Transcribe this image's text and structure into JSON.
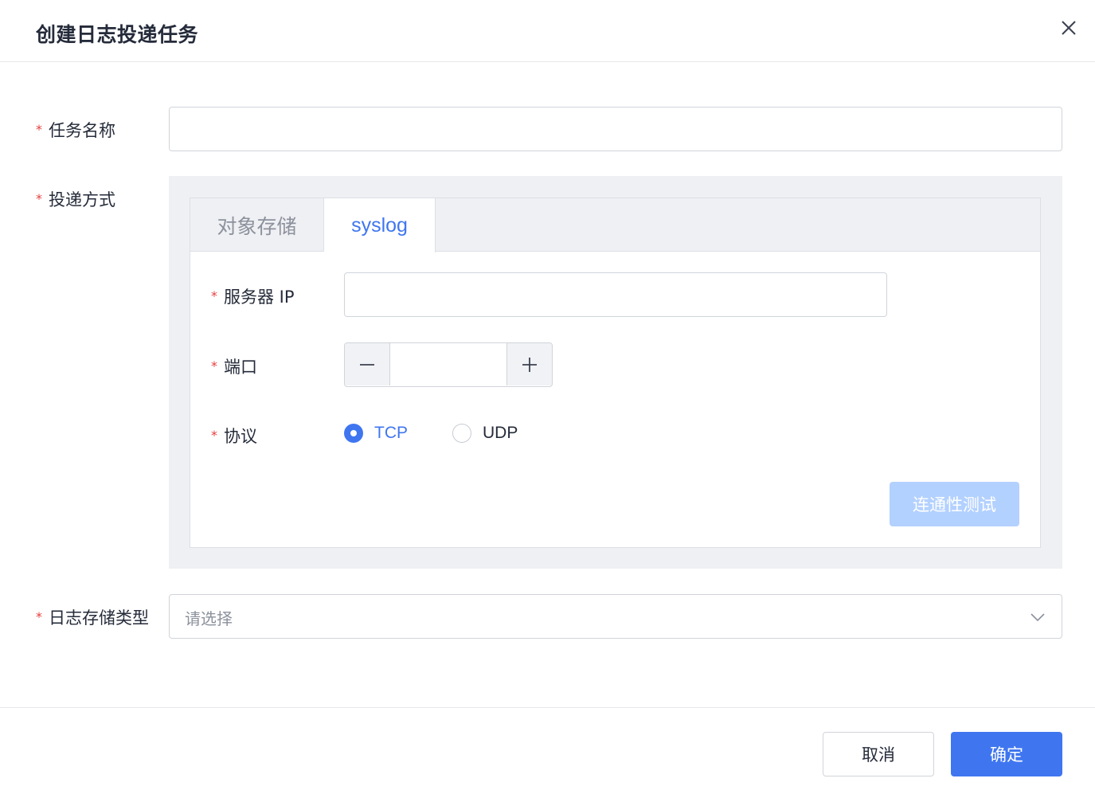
{
  "dialog": {
    "title": "创建日志投递任务",
    "close_icon": "close-icon"
  },
  "form": {
    "task_name": {
      "required_mark": "*",
      "label": "任务名称",
      "value": "",
      "placeholder": ""
    },
    "delivery_method": {
      "required_mark": "*",
      "label": "投递方式",
      "tabs": [
        {
          "label": "对象存储",
          "active": false
        },
        {
          "label": "syslog",
          "active": true
        }
      ],
      "server_ip": {
        "required_mark": "*",
        "label": "服务器 IP",
        "value": ""
      },
      "port": {
        "required_mark": "*",
        "label": "端口",
        "value": "",
        "minus_glyph": "—",
        "plus_glyph": "+"
      },
      "protocol": {
        "required_mark": "*",
        "label": "协议",
        "options": [
          {
            "label": "TCP",
            "selected": true
          },
          {
            "label": "UDP",
            "selected": false
          }
        ]
      },
      "test_button": "连通性测试"
    },
    "storage_type": {
      "required_mark": "*",
      "label": "日志存储类型",
      "placeholder": "请选择",
      "chevron_icon": "chevron-down-icon"
    }
  },
  "footer": {
    "cancel_label": "取消",
    "ok_label": "确定"
  },
  "colors": {
    "primary": "#3f76f0",
    "primary_disabled": "#b3d1ff",
    "required": "#e63f3f",
    "panel_bg": "#eff0f4"
  }
}
